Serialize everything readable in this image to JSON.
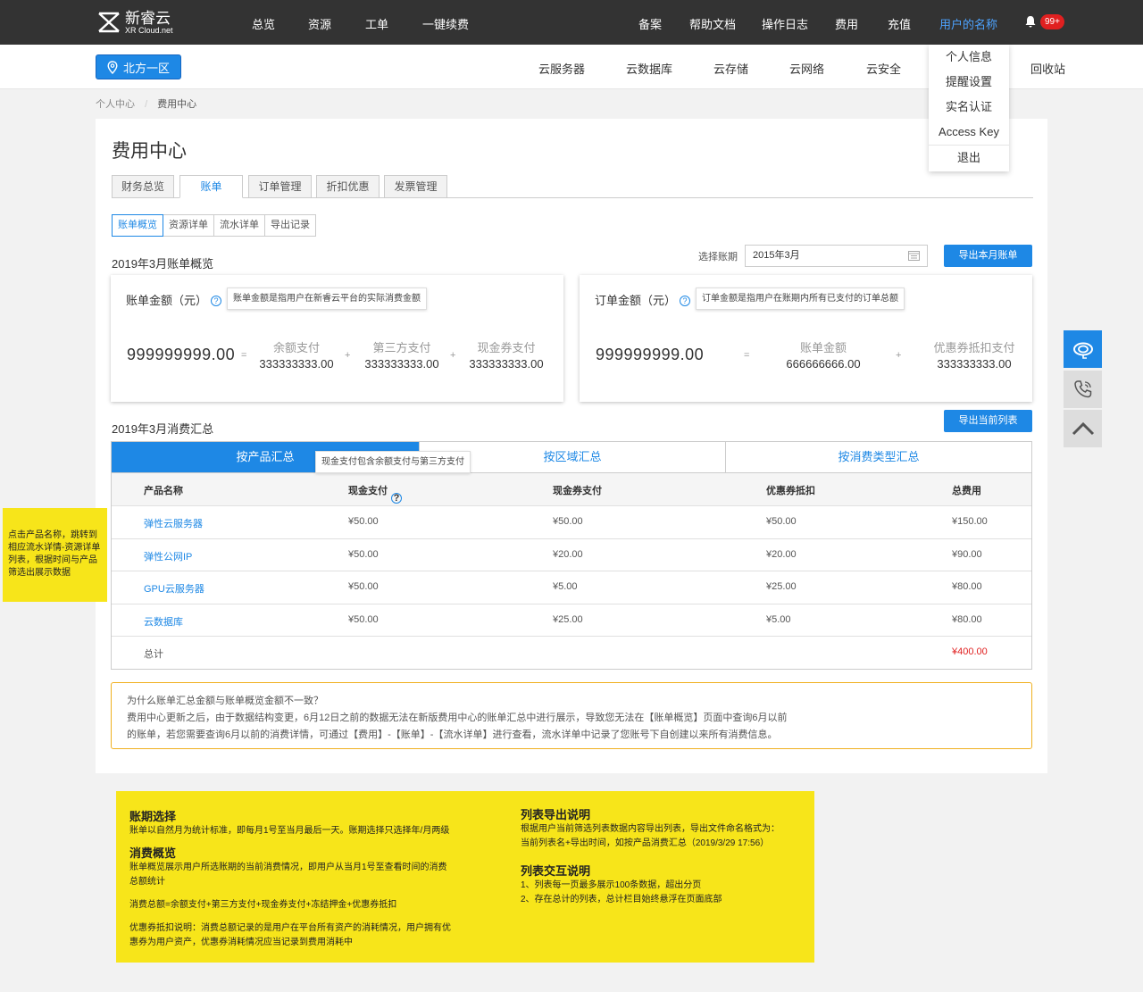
{
  "brand": {
    "cn": "新睿云",
    "en": "XR Cloud.net"
  },
  "topnav": [
    "总览",
    "资源",
    "工单",
    "一键续费",
    "备案",
    "帮助文档",
    "操作日志",
    "费用",
    "充值",
    "用户的名称"
  ],
  "notif_badge": "99+",
  "region": "北方一区",
  "subnav": [
    "云服务器",
    "云数据库",
    "云存储",
    "云网络",
    "云安全",
    "回收站"
  ],
  "user_menu": [
    "个人信息",
    "提醒设置",
    "实名认证",
    "Access Key",
    "退出"
  ],
  "breadcrumb": {
    "home": "个人中心",
    "sep": "/",
    "current": "费用中心"
  },
  "page_title": "费用中心",
  "tabs": [
    "财务总览",
    "账单",
    "订单管理",
    "折扣优惠",
    "发票管理"
  ],
  "subtabs": [
    "账单概览",
    "资源详单",
    "流水详单",
    "导出记录"
  ],
  "overview_title": "2019年3月账单概览",
  "period": {
    "label": "选择账期",
    "value": "2015年3月"
  },
  "export_month_btn": "导出本月账单",
  "bill_card": {
    "title": "账单金额（元）",
    "tip": "账单金额是指用户在新睿云平台的实际消费金额",
    "total": "999999999.00",
    "eq": "=",
    "plus": "+",
    "items": [
      {
        "label": "余额支付",
        "value": "333333333.00"
      },
      {
        "label": "第三方支付",
        "value": "333333333.00"
      },
      {
        "label": "现金券支付",
        "value": "333333333.00"
      }
    ]
  },
  "order_card": {
    "title": "订单金额（元）",
    "tip": "订单金额是指用户在账期内所有已支付的订单总额",
    "total": "999999999.00",
    "eq": "=",
    "plus": "+",
    "items": [
      {
        "label": "账单金额",
        "value": "666666666.00"
      },
      {
        "label": "优惠券抵扣支付",
        "value": "333333333.00"
      }
    ]
  },
  "summary_title": "2019年3月消费汇总",
  "export_list_btn": "导出当前列表",
  "summary_tabs": [
    "按产品汇总",
    "按区域汇总",
    "按消费类型汇总"
  ],
  "cash_tip": "现金支付包含余额支付与第三方支付",
  "table": {
    "headers": [
      "产品名称",
      "现金支付",
      "现金券支付",
      "优惠券抵扣",
      "总费用"
    ],
    "rows": [
      [
        "弹性云服务器",
        "¥50.00",
        "¥50.00",
        "¥50.00",
        "¥150.00"
      ],
      [
        "弹性公网IP",
        "¥50.00",
        "¥20.00",
        "¥20.00",
        "¥90.00"
      ],
      [
        "GPU云服务器",
        "¥50.00",
        "¥5.00",
        "¥25.00",
        "¥80.00"
      ],
      [
        "云数据库",
        "¥50.00",
        "¥25.00",
        "¥5.00",
        "¥80.00"
      ]
    ],
    "total_label": "总计",
    "total_value": "¥400.00"
  },
  "notice": {
    "q": "为什么账单汇总金额与账单概览金额不一致？",
    "l1": "费用中心更新之后，由于数据结构变更，6月12日之前的数据无法在新版费用中心的账单汇总中进行展示，导致您无法在【账单概览】页面中查询6月以前",
    "l2": "的账单，若您需要查询6月以前的消费详情，可通过【费用】-【账单】-【流水详单】进行查看，流水详单中记录了您账号下自创建以来所有消费信息。"
  },
  "left_note": "点击产品名称，跳转到相应流水详情-资源详单列表，根据时间与产品筛选出展示数据",
  "notes": {
    "h1": "账期选择",
    "p1": "账单以自然月为统计标准，即每月1号至当月最后一天。账期选择只选择年/月两级",
    "h2": "消费概览",
    "p2a": "账单概览展示用户所选账期的当前消费情况，即用户从当月1号至查看时间的消费",
    "p2b": "总额统计",
    "p3": "消费总额=余额支付+第三方支付+现金券支付+冻结押金+优惠券抵扣",
    "p4a": "优惠券抵扣说明：消费总额记录的是用户在平台所有资产的消耗情况，用户拥有优",
    "p4b": "惠券为用户资产，优惠券消耗情况应当记录到费用消耗中",
    "h3": "列表导出说明",
    "p5a": "根据用户当前筛选列表数据内容导出列表，导出文件命名格式为：",
    "p5b": "当前列表名+导出时间，如按产品消费汇总（2019/3/29 17:56）",
    "h4": "列表交互说明",
    "p6a": "1、列表每一页最多展示100条数据，超出分页",
    "p6b": "2、存在总计的列表，总计栏目始终悬浮在页面底部"
  },
  "colors": {
    "primary": "#1e88e5",
    "topbar": "#333333",
    "note": "#f7e51a",
    "red": "#e02020"
  }
}
